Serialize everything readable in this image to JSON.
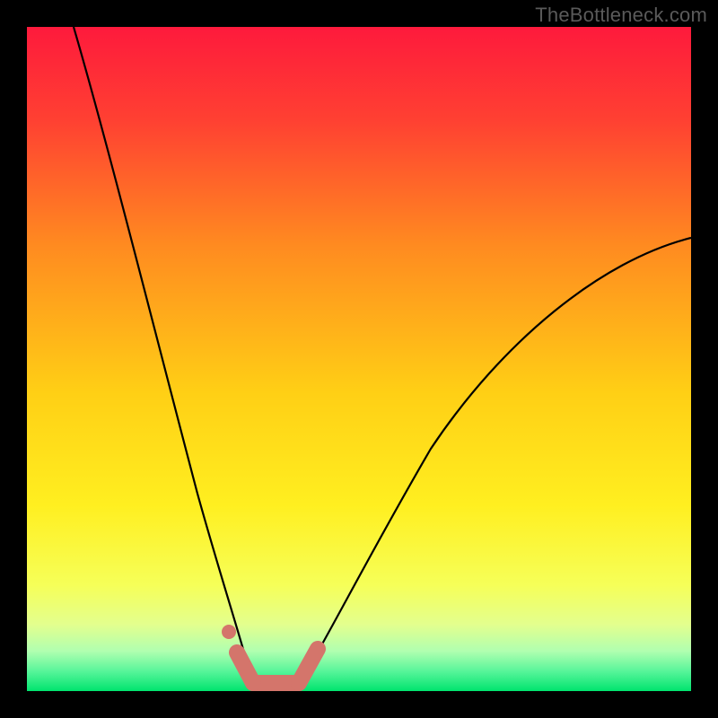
{
  "watermark": "TheBottleneck.com",
  "colors": {
    "bg_top": "#fe1a3c",
    "bg_mid_top": "#ff8b20",
    "bg_mid": "#ffe21a",
    "bg_low": "#f5ff60",
    "bg_green_top": "#b8ff87",
    "bg_green": "#00e46e",
    "curve": "#000000",
    "accent": "#d4756b",
    "frame": "#000000"
  },
  "chart_data": {
    "type": "line",
    "title": "",
    "xlabel": "",
    "ylabel": "",
    "xlim": [
      0,
      100
    ],
    "ylim": [
      0,
      100
    ],
    "series": [
      {
        "name": "left-branch",
        "x": [
          7,
          10,
          13,
          16,
          19,
          22,
          25,
          28,
          30,
          32,
          33,
          34
        ],
        "y": [
          100,
          85,
          71,
          58,
          46,
          35,
          25,
          16,
          9,
          4,
          2,
          0
        ]
      },
      {
        "name": "right-branch",
        "x": [
          41,
          43,
          46,
          50,
          55,
          61,
          68,
          76,
          85,
          95,
          100
        ],
        "y": [
          0,
          3,
          8,
          15,
          23,
          32,
          41,
          50,
          58,
          65,
          68
        ]
      }
    ],
    "accent_segments": [
      {
        "name": "flat-bottom",
        "x": [
          34,
          41
        ],
        "y": [
          0.5,
          0.5
        ]
      },
      {
        "name": "left-tail",
        "x": [
          31.5,
          34
        ],
        "y": [
          5,
          0.5
        ]
      },
      {
        "name": "right-tail",
        "x": [
          41,
          44
        ],
        "y": [
          0.5,
          5
        ]
      }
    ],
    "accent_dot": {
      "x": 30.3,
      "y": 8
    }
  }
}
